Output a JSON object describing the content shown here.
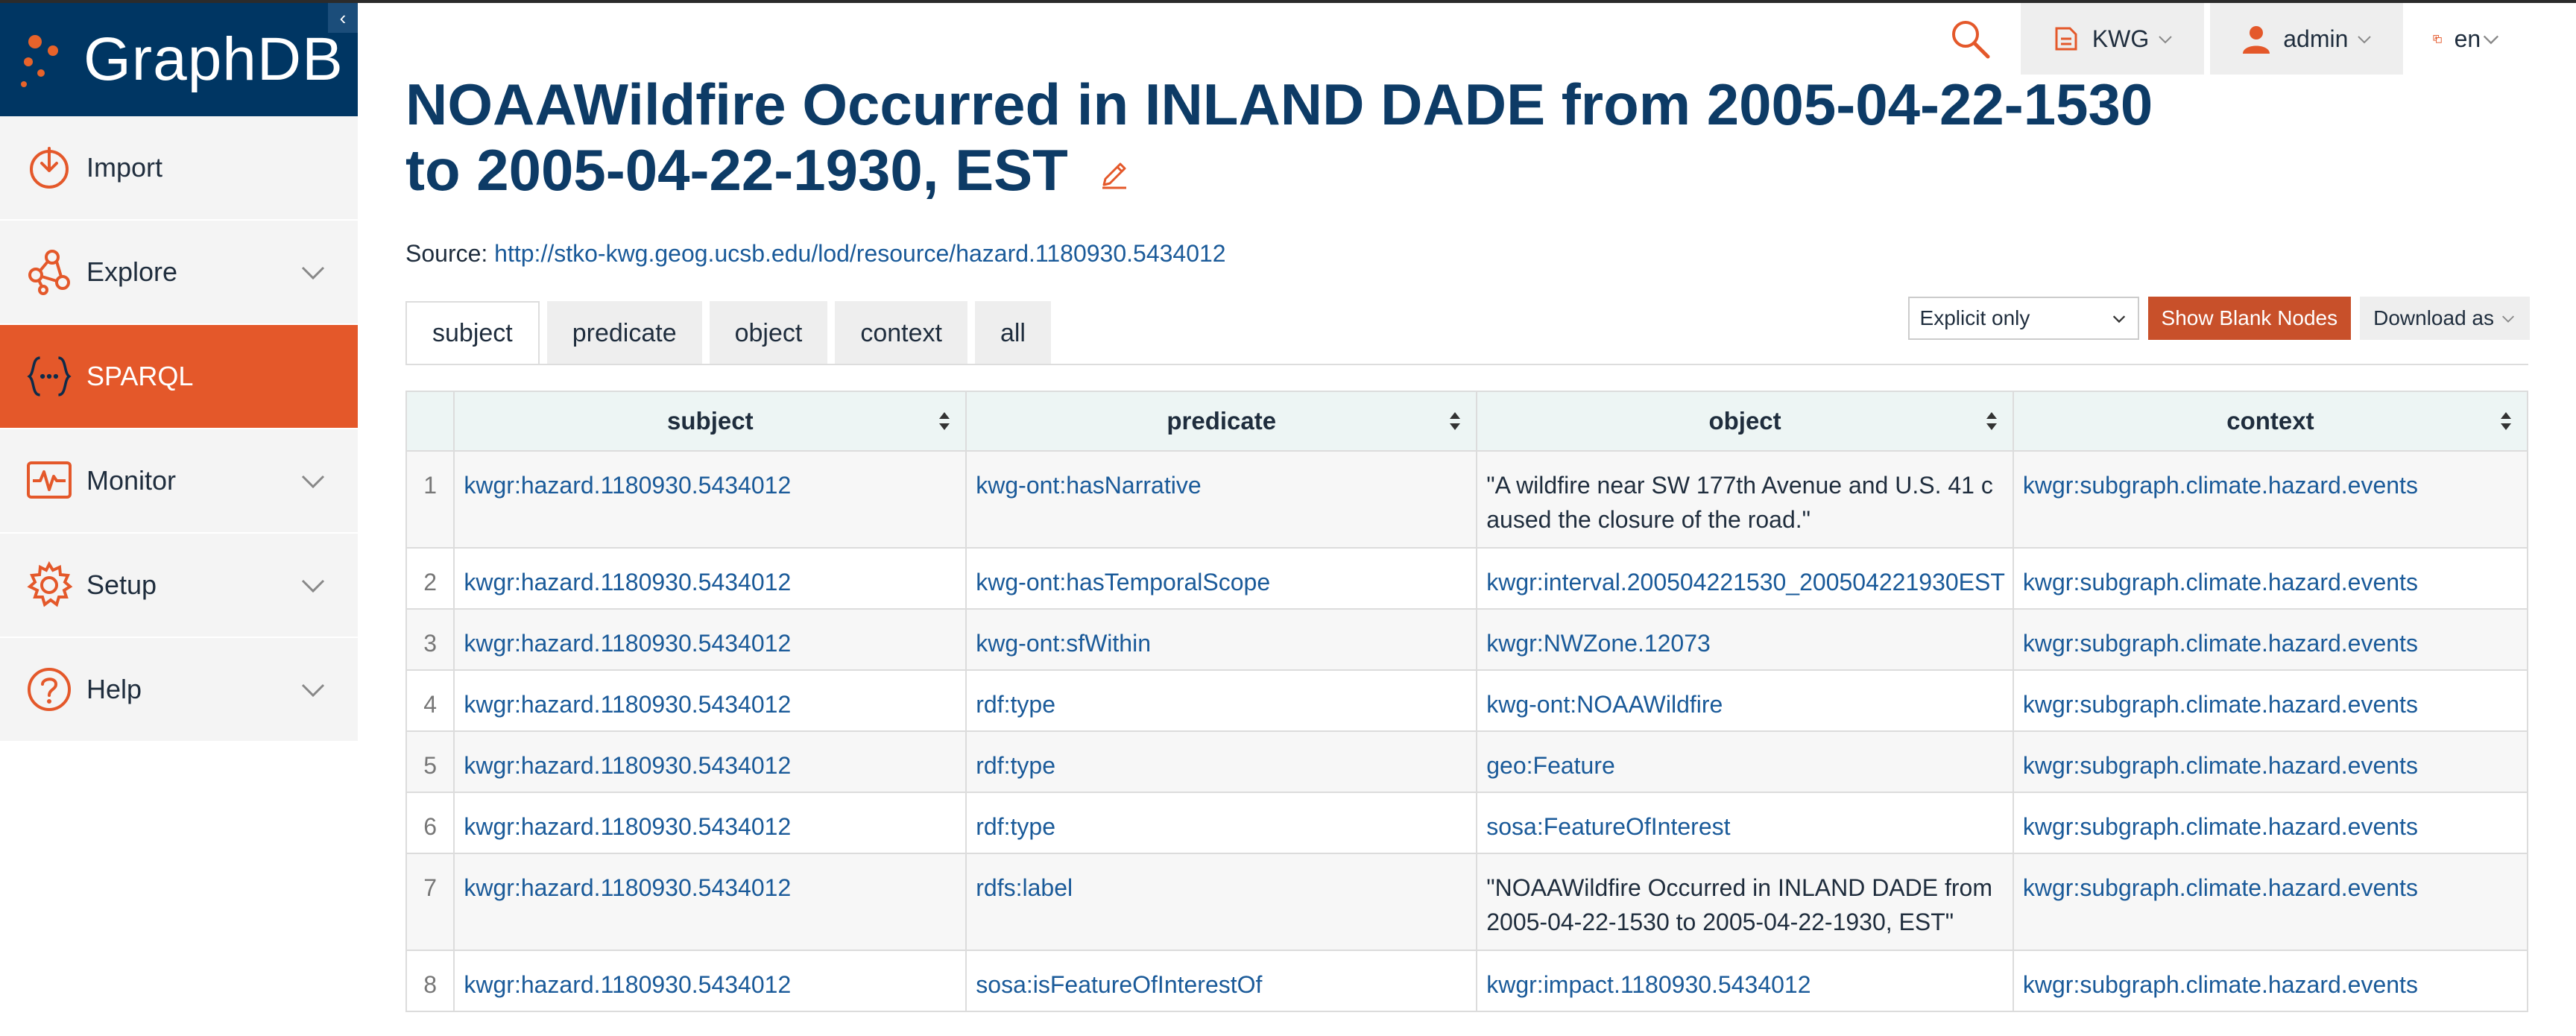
{
  "app": {
    "brand": "GraphDB",
    "collapse_glyph": "‹"
  },
  "sidebar": {
    "items": [
      {
        "label": "Import",
        "icon": "import-icon",
        "has_chevron": false,
        "active": false
      },
      {
        "label": "Explore",
        "icon": "explore-icon",
        "has_chevron": true,
        "active": false
      },
      {
        "label": "SPARQL",
        "icon": "sparql-icon",
        "has_chevron": false,
        "active": true
      },
      {
        "label": "Monitor",
        "icon": "monitor-icon",
        "has_chevron": true,
        "active": false
      },
      {
        "label": "Setup",
        "icon": "gear-icon",
        "has_chevron": true,
        "active": false
      },
      {
        "label": "Help",
        "icon": "help-icon",
        "has_chevron": true,
        "active": false
      }
    ]
  },
  "header": {
    "repository": "KWG",
    "user": "admin",
    "language": "en"
  },
  "page": {
    "title": "NOAAWildfire Occurred in INLAND DADE from 2005-04-22-1530 to 2005-04-22-1930, EST",
    "source_label": "Source: ",
    "source_url": "http://stko-kwg.geog.ucsb.edu/lod/resource/hazard.1180930.5434012"
  },
  "tabs": [
    "subject",
    "predicate",
    "object",
    "context",
    "all"
  ],
  "controls": {
    "filter_value": "Explicit only",
    "blank_nodes_label": "Show Blank Nodes",
    "download_label": "Download as"
  },
  "table": {
    "columns": [
      "subject",
      "predicate",
      "object",
      "context"
    ],
    "rows": [
      {
        "n": "1",
        "subject": "kwgr:hazard.1180930.5434012",
        "predicate": "kwg-ont:hasNarrative",
        "object": "\"A wildfire near SW 177th Avenue and U.S. 41 caused the closure of the road.\"",
        "object_literal": true,
        "context": "kwgr:subgraph.climate.hazard.events"
      },
      {
        "n": "2",
        "subject": "kwgr:hazard.1180930.5434012",
        "predicate": "kwg-ont:hasTemporalScope",
        "object": "kwgr:interval.200504221530_200504221930EST",
        "object_literal": false,
        "context": "kwgr:subgraph.climate.hazard.events"
      },
      {
        "n": "3",
        "subject": "kwgr:hazard.1180930.5434012",
        "predicate": "kwg-ont:sfWithin",
        "object": "kwgr:NWZone.12073",
        "object_literal": false,
        "context": "kwgr:subgraph.climate.hazard.events"
      },
      {
        "n": "4",
        "subject": "kwgr:hazard.1180930.5434012",
        "predicate": "rdf:type",
        "object": "kwg-ont:NOAAWildfire",
        "object_literal": false,
        "context": "kwgr:subgraph.climate.hazard.events"
      },
      {
        "n": "5",
        "subject": "kwgr:hazard.1180930.5434012",
        "predicate": "rdf:type",
        "object": "geo:Feature",
        "object_literal": false,
        "context": "kwgr:subgraph.climate.hazard.events"
      },
      {
        "n": "6",
        "subject": "kwgr:hazard.1180930.5434012",
        "predicate": "rdf:type",
        "object": "sosa:FeatureOfInterest",
        "object_literal": false,
        "context": "kwgr:subgraph.climate.hazard.events"
      },
      {
        "n": "7",
        "subject": "kwgr:hazard.1180930.5434012",
        "predicate": "rdfs:label",
        "object": "\"NOAAWildfire Occurred in INLAND DADE from 2005-04-22-1530 to 2005-04-22-1930, EST\"",
        "object_literal": true,
        "context": "kwgr:subgraph.climate.hazard.events"
      },
      {
        "n": "8",
        "subject": "kwgr:hazard.1180930.5434012",
        "predicate": "sosa:isFeatureOfInterestOf",
        "object": "kwgr:impact.1180930.5434012",
        "object_literal": false,
        "context": "kwgr:subgraph.climate.hazard.events"
      }
    ]
  },
  "colors": {
    "accent": "#e4582a",
    "navy": "#003663",
    "link": "#1a5a99",
    "title": "#0d3b66"
  }
}
